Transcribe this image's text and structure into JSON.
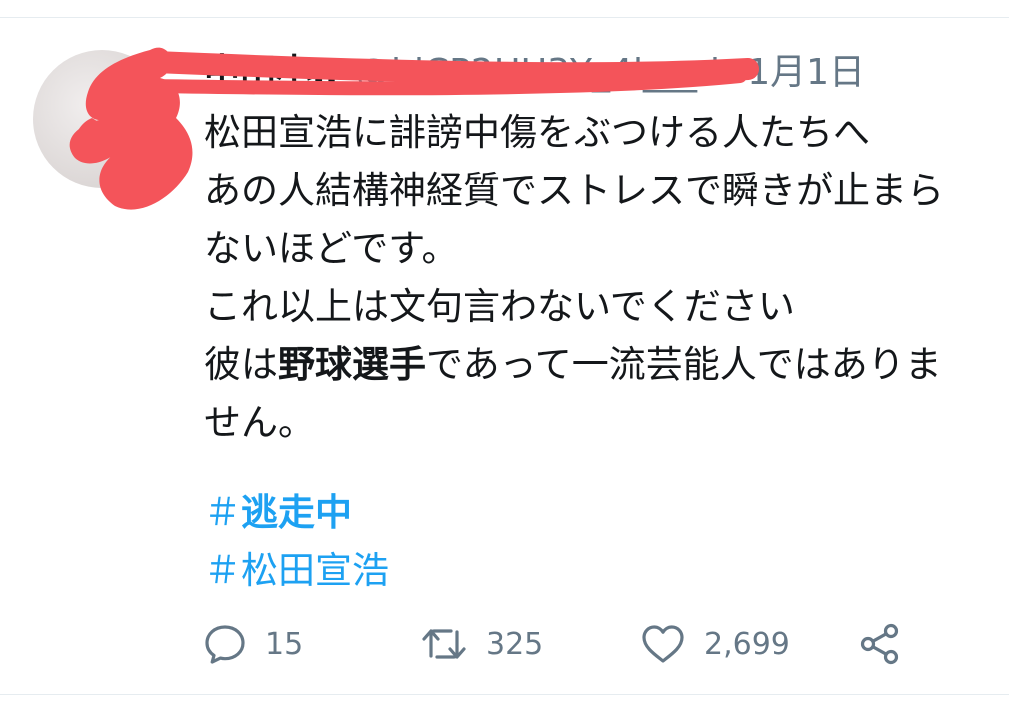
{
  "tweet": {
    "author": {
      "display_name": "中田小Jr",
      "handle": "@hiCP2HU3Y_4l___d",
      "separator": "·",
      "date": "1月1日"
    },
    "text_lines": [
      "松田宣浩に誹謗中傷をぶつける人たちへ",
      "あの人結構神経質でストレスで瞬きが止まら",
      "ないほどです。",
      "これ以上は文句言わないでください"
    ],
    "line5_before": "彼は",
    "line5_bold": "野球選手",
    "line5_after": "であって一流芸能人ではありま",
    "line6": "せん。",
    "hashtags": [
      {
        "hash": "＃",
        "tag": "逃走中"
      },
      {
        "hash": "＃",
        "tag": "松田宣浩"
      }
    ],
    "actions": {
      "reply_count": "15",
      "retweet_count": "325",
      "like_count": "2,699"
    },
    "icons": {
      "reply": "reply-icon",
      "retweet": "retweet-icon",
      "like": "heart-icon",
      "share": "share-icon"
    },
    "colors": {
      "link": "#1da1f2",
      "muted": "#657786",
      "redaction": "#f4545a"
    }
  }
}
